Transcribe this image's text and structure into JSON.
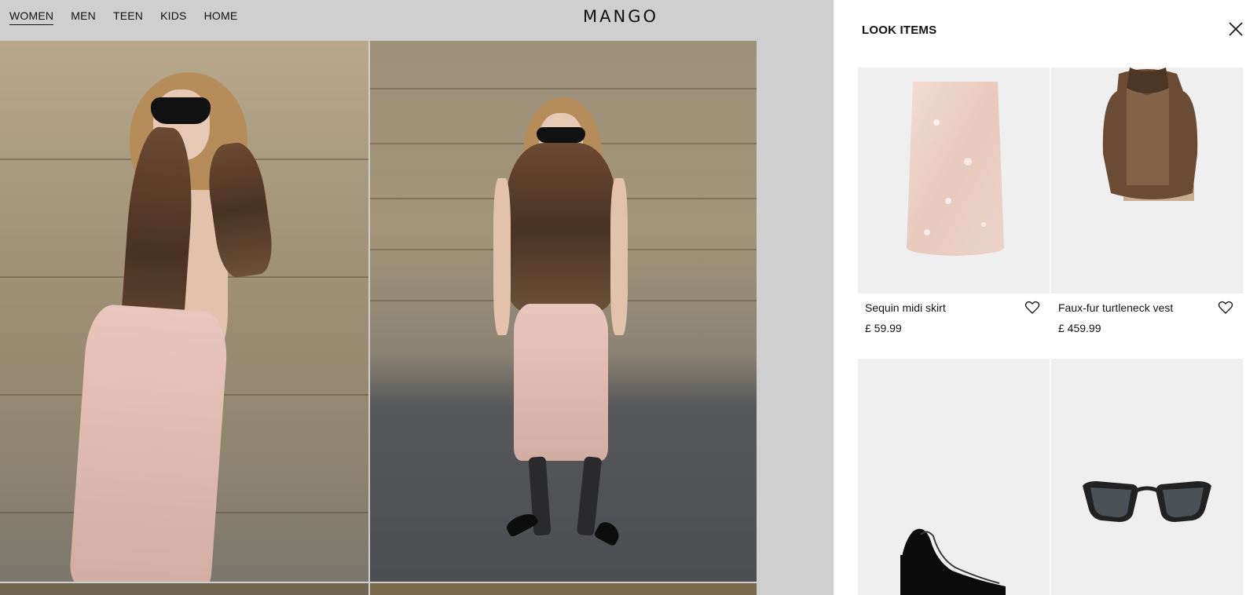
{
  "header": {
    "nav": [
      "WOMEN",
      "MEN",
      "TEEN",
      "KIDS",
      "HOME"
    ],
    "active_nav": "WOMEN",
    "logo": "MANGO"
  },
  "panel": {
    "title": "LOOK ITEMS",
    "close_icon": "close-icon",
    "items": [
      {
        "name": "Sequin midi skirt",
        "price": "£ 59.99",
        "icon": "heart-icon"
      },
      {
        "name": "Faux-fur turtleneck vest",
        "price": "£ 459.99",
        "icon": "heart-icon"
      },
      {
        "name": "",
        "price": "",
        "icon": ""
      },
      {
        "name": "",
        "price": "",
        "icon": ""
      }
    ]
  },
  "colors": {
    "overlay_bg": "#d4d4d4",
    "panel_bg": "#ffffff",
    "product_bg": "#efefef",
    "text": "#111111"
  }
}
